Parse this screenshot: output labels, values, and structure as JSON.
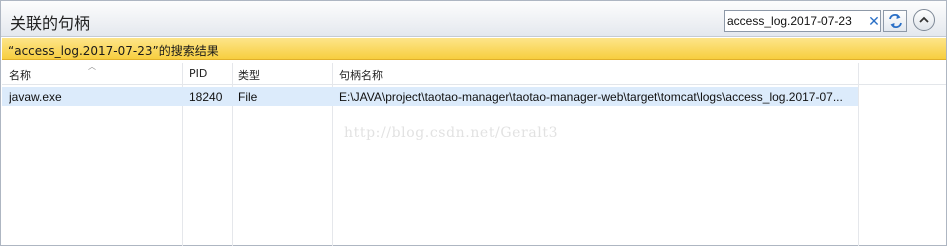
{
  "window": {
    "title": "关联的句柄"
  },
  "search": {
    "value": "access_log.2017-07-23",
    "clear_icon": "✕"
  },
  "result_bar": {
    "text": "“access_log.2017-07-23”的搜索结果"
  },
  "table": {
    "columns": [
      "名称",
      "PID",
      "类型",
      "句柄名称"
    ],
    "sort_indicator": "︿",
    "rows": [
      {
        "name": "javaw.exe",
        "pid": "18240",
        "type": "File",
        "handle": "E:\\JAVA\\project\\taotao-manager\\taotao-manager-web\\target\\tomcat\\logs\\access_log.2017-07..."
      }
    ]
  },
  "watermark": {
    "text": "http://blog.csdn.net/Geralt3"
  },
  "icons": {
    "refresh": "refresh-icon",
    "collapse": "chevron-up-icon"
  },
  "colors": {
    "result_bar": "#f7ce3f",
    "selected_row": "#dcebfb",
    "accent": "#2a6fc6"
  }
}
